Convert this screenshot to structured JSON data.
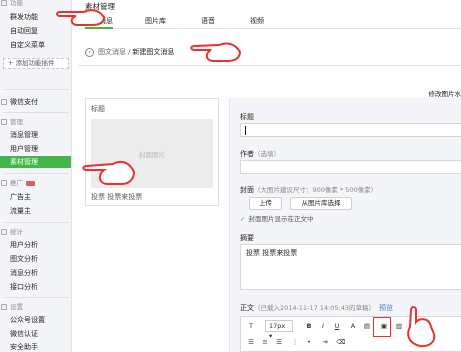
{
  "sidebar": {
    "group_function": "功能",
    "items_function": [
      "群发功能",
      "自动回复",
      "自定义菜单"
    ],
    "add_plugin": "添加功能插件",
    "wxpay": "微信支付",
    "group_manage": "管理",
    "items_manage": [
      "消息管理",
      "用户管理",
      "素材管理"
    ],
    "group_promote": "推广",
    "items_promote": [
      "广告主",
      "流量主"
    ],
    "group_stats": "统计",
    "items_stats": [
      "用户分析",
      "图文分析",
      "消息分析",
      "接口分析"
    ],
    "group_settings": "设置",
    "items_settings": [
      "公众号设置",
      "微信认证",
      "安全助手"
    ]
  },
  "main": {
    "title": "素材管理",
    "tabs": [
      "图文消息",
      "图片库",
      "语音",
      "视频"
    ],
    "breadcrumb_parent": "图文消息",
    "breadcrumb_sep": "/",
    "breadcrumb_current": "新建图文消息",
    "right_note": "修改图片水"
  },
  "preview": {
    "label": "标题",
    "cover_placeholder": "封面图片",
    "summary": "投票 投票来投票"
  },
  "editor": {
    "title_label": "标题",
    "author_label": "作者",
    "author_hint": "（选填）",
    "cover_label": "封面",
    "cover_hint": "（大图片建议尺寸：900像素 * 500像素）",
    "upload_button": "上传",
    "library_button": "从图片库选择",
    "cover_show_text": "封面图片显示在正文中",
    "summary_label": "摘要",
    "summary_value": "投票 投票来投票",
    "body_label": "正文",
    "body_hint": "（已载入2014-11-17 14:05:43的草稿）",
    "preview_link": "预览",
    "font_size_value": "17px"
  }
}
